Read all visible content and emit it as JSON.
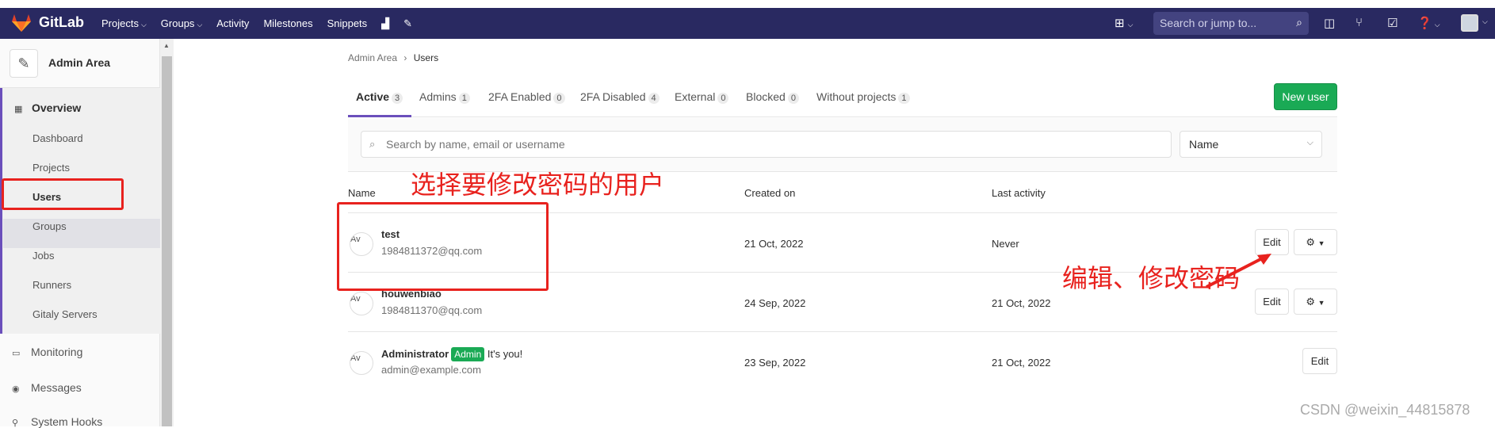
{
  "navbar": {
    "brand": "GitLab",
    "menu": [
      "Projects",
      "Groups",
      "Activity",
      "Milestones",
      "Snippets"
    ],
    "search_placeholder": "Search or jump to..."
  },
  "sidebar": {
    "header_title": "Admin Area",
    "overview_label": "Overview",
    "sub_items": [
      "Dashboard",
      "Projects",
      "Users",
      "Groups",
      "Jobs",
      "Runners",
      "Gitaly Servers"
    ],
    "active_item": "Users",
    "other_items": [
      "Monitoring",
      "Messages",
      "System Hooks"
    ]
  },
  "breadcrumb": {
    "root": "Admin Area",
    "sep": "›",
    "current": "Users"
  },
  "tabs": [
    {
      "label": "Active",
      "count": "3"
    },
    {
      "label": "Admins",
      "count": "1"
    },
    {
      "label": "2FA Enabled",
      "count": "0"
    },
    {
      "label": "2FA Disabled",
      "count": "4"
    },
    {
      "label": "External",
      "count": "0"
    },
    {
      "label": "Blocked",
      "count": "0"
    },
    {
      "label": "Without projects",
      "count": "1"
    }
  ],
  "new_user_label": "New user",
  "filter": {
    "search_placeholder": "Search by name, email or username",
    "sort_value": "Name"
  },
  "table": {
    "headers": {
      "name": "Name",
      "created": "Created on",
      "last": "Last activity"
    },
    "rows": [
      {
        "avatar_alt": "Av",
        "name": "test",
        "email": "1984811372@qq.com",
        "created": "21 Oct, 2022",
        "last": "Never",
        "edit": "Edit"
      },
      {
        "avatar_alt": "Av",
        "name": "houwenbiao",
        "email": "1984811370@qq.com",
        "created": "24 Sep, 2022",
        "last": "21 Oct, 2022",
        "edit": "Edit"
      },
      {
        "avatar_alt": "Av",
        "name": "Administrator",
        "badge": "Admin",
        "you": "It's you!",
        "email": "admin@example.com",
        "created": "23 Sep, 2022",
        "last": "21 Oct, 2022",
        "edit": "Edit"
      }
    ]
  },
  "annotations": {
    "select_user": "选择要修改密码的用户",
    "edit_password": "编辑、修改密码",
    "color": "#e8221e"
  },
  "watermark": "CSDN @weixin_44815878"
}
